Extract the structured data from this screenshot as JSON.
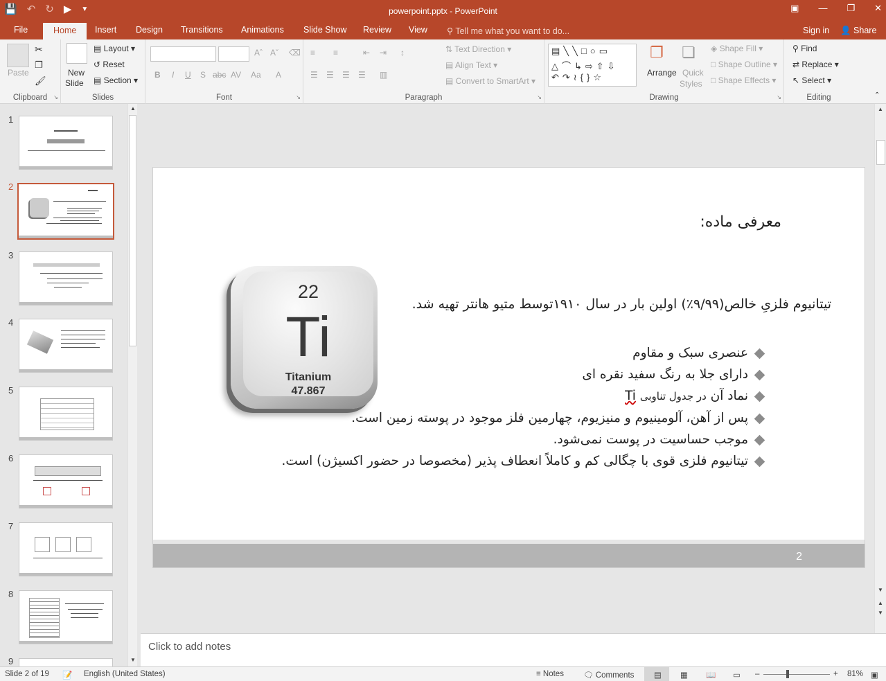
{
  "window": {
    "title": "powerpoint.pptx - PowerPoint"
  },
  "tabs": [
    {
      "label": "File"
    },
    {
      "label": "Home"
    },
    {
      "label": "Insert"
    },
    {
      "label": "Design"
    },
    {
      "label": "Transitions"
    },
    {
      "label": "Animations"
    },
    {
      "label": "Slide Show"
    },
    {
      "label": "Review"
    },
    {
      "label": "View"
    }
  ],
  "tellme": "Tell me what you want to do...",
  "signin": "Sign in",
  "share": "Share",
  "ribbon": {
    "clipboard": {
      "label": "Clipboard",
      "paste": "Paste"
    },
    "slides": {
      "label": "Slides",
      "new_slide": "New",
      "new_slide2": "Slide",
      "layout": "Layout",
      "reset": "Reset",
      "section": "Section"
    },
    "font": {
      "label": "Font"
    },
    "paragraph": {
      "label": "Paragraph",
      "text_direction": "Text Direction",
      "align_text": "Align Text",
      "smartart": "Convert to SmartArt"
    },
    "drawing": {
      "label": "Drawing",
      "arrange": "Arrange",
      "quick_styles": "Quick",
      "quick_styles2": "Styles",
      "shape_fill": "Shape Fill",
      "shape_outline": "Shape Outline",
      "shape_effects": "Shape Effects"
    },
    "editing": {
      "label": "Editing",
      "find": "Find",
      "replace": "Replace",
      "select": "Select"
    }
  },
  "thumbnails": [
    "1",
    "2",
    "3",
    "4",
    "5",
    "6",
    "7",
    "8",
    "9"
  ],
  "slide": {
    "title": "معرفی ماده:",
    "intro": "تیتانیوم فلزیِ خالص(۹/۹۹٪) اولین بار در سال ۱۹۱۰توسط متیو هانتر تهیه شد.",
    "bullets": [
      "عنصری سبک و مقاوم",
      "دارای جلا به رنگ سفید نقره ای",
      "موجب حساسیت در پوست نمی‌شود.",
      "تیتانیوم فلزی قوی با چگالی کم و کاملاً انعطاف پذیر (مخصوصا در حضور اکسیژن) است."
    ],
    "symbol_line": {
      "prefix": "نماد آن",
      "mid": "در جدول تناوبی",
      "symbol": "Ti"
    },
    "abundance_line": "پس از آهن، آلومینیوم و منیزیوم، چهارمین فلز موجود در پوسته زمین است.",
    "number": "2",
    "tile": {
      "number": "22",
      "symbol": "Ti",
      "name": "Titanium",
      "mass": "47.867"
    }
  },
  "notes_placeholder": "Click to add notes",
  "status": {
    "slide": "Slide 2 of 19",
    "language": "English (United States)",
    "notes": "Notes",
    "comments": "Comments",
    "zoom": "81%"
  }
}
